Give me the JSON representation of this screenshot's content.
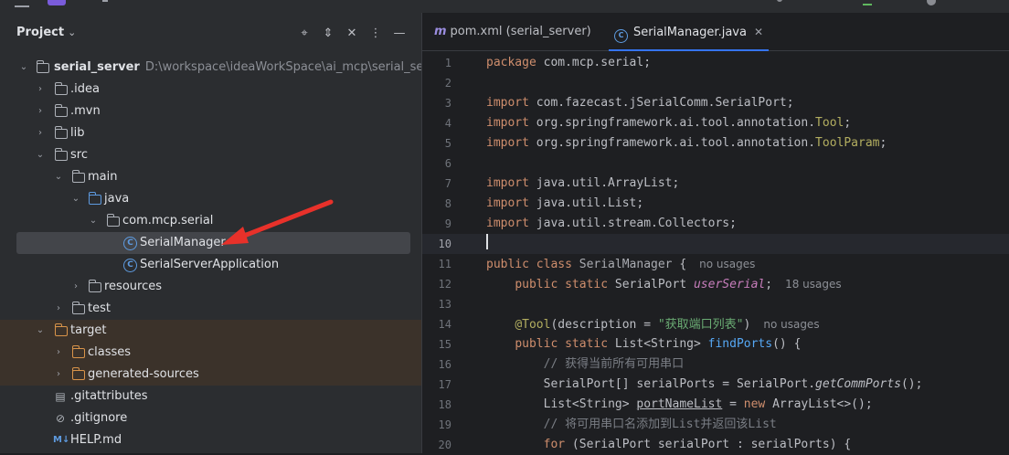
{
  "project": {
    "title": "Project",
    "tree": [
      {
        "name": "serial_server",
        "path": "D:\\workspace\\ideaWorkSpace\\ai_mcp\\serial_server"
      },
      {
        "name": ".idea"
      },
      {
        "name": ".mvn"
      },
      {
        "name": "lib"
      },
      {
        "name": "src"
      },
      {
        "name": "main"
      },
      {
        "name": "java"
      },
      {
        "name": "com.mcp.serial"
      },
      {
        "name": "SerialManager"
      },
      {
        "name": "SerialServerApplication"
      },
      {
        "name": "resources"
      },
      {
        "name": "test"
      },
      {
        "name": "target"
      },
      {
        "name": "classes"
      },
      {
        "name": "generated-sources"
      },
      {
        "name": ".gitattributes"
      },
      {
        "name": ".gitignore"
      },
      {
        "name": "HELP.md"
      }
    ]
  },
  "editor": {
    "tabs": [
      {
        "label": "pom.xml (serial_server)"
      },
      {
        "label": "SerialManager.java"
      }
    ],
    "lines": [
      {
        "n": "1",
        "a": "package",
        "b": " com.mcp.serial;"
      },
      {
        "n": "2"
      },
      {
        "n": "3",
        "a": "import",
        "b": " com.fazecast.jSerialComm.SerialPort;"
      },
      {
        "n": "4",
        "a": "import",
        "b": " org.springframework.ai.tool.annotation.",
        "c": "Tool",
        "d": ";"
      },
      {
        "n": "5",
        "a": "import",
        "b": " org.springframework.ai.tool.annotation.",
        "c": "ToolParam",
        "d": ";"
      },
      {
        "n": "6"
      },
      {
        "n": "7",
        "a": "import",
        "b": " java.util.ArrayList;"
      },
      {
        "n": "8",
        "a": "import",
        "b": " java.util.List;"
      },
      {
        "n": "9",
        "a": "import",
        "b": " java.util.stream.Collectors;"
      },
      {
        "n": "10"
      },
      {
        "n": "11",
        "a": "public class",
        "b": " SerialManager",
        "c": " {",
        "hint": "no usages"
      },
      {
        "n": "12",
        "a": "public static",
        "b": " SerialPort ",
        "c": "userSerial",
        "d": ";",
        "hint": "18 usages"
      },
      {
        "n": "13"
      },
      {
        "n": "14",
        "a": "@Tool",
        "b": "(description = ",
        "c": "\"获取端口列表\"",
        "d": ")",
        "hint": "no usages"
      },
      {
        "n": "15",
        "a": "public static",
        "b": " List<String> ",
        "c": "findPorts",
        "d": "() {"
      },
      {
        "n": "16",
        "a": "// 获得当前所有可用串口"
      },
      {
        "n": "17",
        "a": "SerialPort[] serialPorts = SerialPort.",
        "b": "getCommPorts",
        "c": "();"
      },
      {
        "n": "18",
        "a": "List<String> ",
        "b": "portNameList",
        "c": " = ",
        "d": "new",
        "e": " ArrayList<>();"
      },
      {
        "n": "19",
        "a": "// 将可用串口名添加到List并返回该List"
      },
      {
        "n": "20",
        "a": "for",
        "b": " (SerialPort serialPort : serialPorts) {"
      }
    ]
  },
  "colors": {
    "panel": "#2b2d30",
    "editor": "#1e1f22",
    "keyword": "#cf8e6d",
    "annotation": "#b3ae60",
    "string": "#6aab73",
    "accent": "#3574f0",
    "arrow": "#e8312a"
  }
}
